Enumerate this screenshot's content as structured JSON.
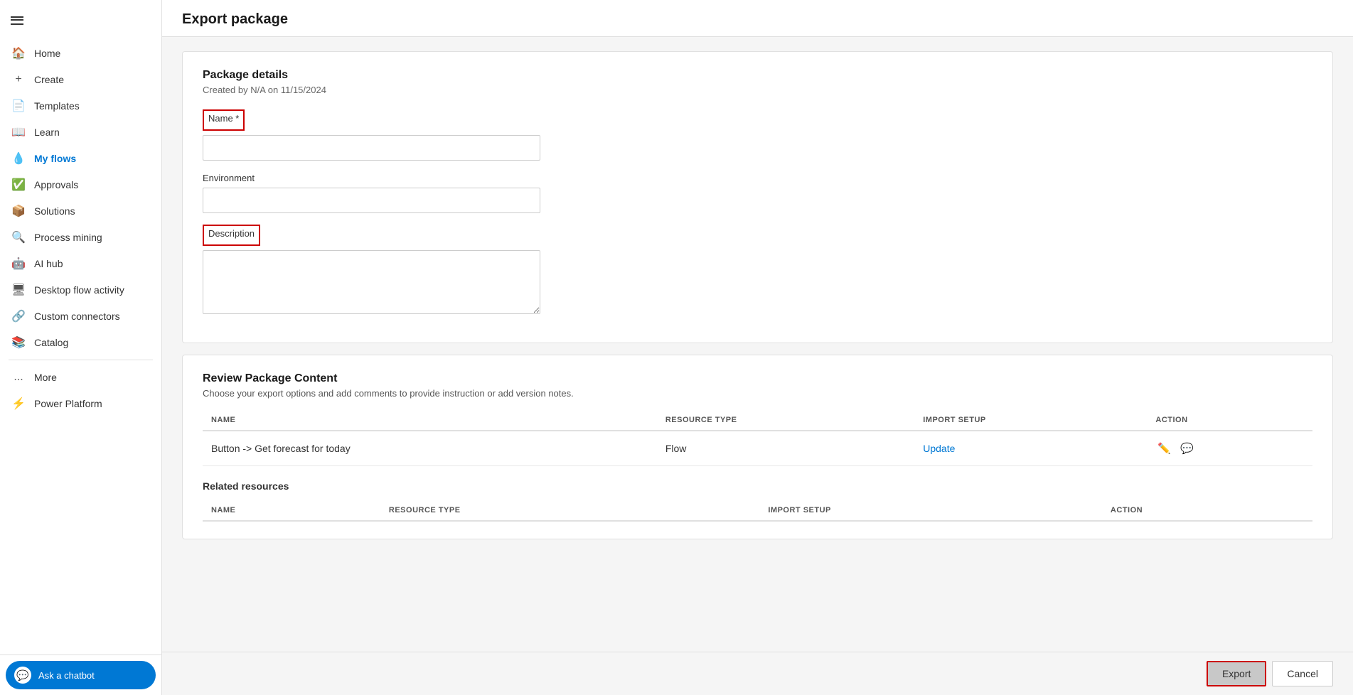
{
  "sidebar": {
    "items": [
      {
        "id": "home",
        "label": "Home",
        "icon": "🏠",
        "active": false
      },
      {
        "id": "create",
        "label": "Create",
        "icon": "+",
        "active": false
      },
      {
        "id": "templates",
        "label": "Templates",
        "icon": "📄",
        "active": false
      },
      {
        "id": "learn",
        "label": "Learn",
        "icon": "📖",
        "active": false
      },
      {
        "id": "my-flows",
        "label": "My flows",
        "icon": "💧",
        "active": true
      },
      {
        "id": "approvals",
        "label": "Approvals",
        "icon": "✅",
        "active": false
      },
      {
        "id": "solutions",
        "label": "Solutions",
        "icon": "📦",
        "active": false
      },
      {
        "id": "process-mining",
        "label": "Process mining",
        "icon": "🔍",
        "active": false
      },
      {
        "id": "ai-hub",
        "label": "AI hub",
        "icon": "🤖",
        "active": false
      },
      {
        "id": "desktop-flow",
        "label": "Desktop flow activity",
        "icon": "🖥",
        "active": false
      },
      {
        "id": "custom-connectors",
        "label": "Custom connectors",
        "icon": "🔗",
        "active": false
      },
      {
        "id": "catalog",
        "label": "Catalog",
        "icon": "📚",
        "active": false
      },
      {
        "id": "more",
        "label": "More",
        "icon": "...",
        "active": false
      },
      {
        "id": "power-platform",
        "label": "Power Platform",
        "icon": "⚡",
        "active": false
      }
    ],
    "chatbot_label": "Ask a chatbot"
  },
  "page": {
    "title": "Export package"
  },
  "package_details": {
    "title": "Package details",
    "subtitle": "Created by N/A on 11/15/2024",
    "name_label": "Name *",
    "name_placeholder": "",
    "environment_label": "Environment",
    "environment_placeholder": "",
    "description_label": "Description",
    "description_placeholder": ""
  },
  "review_package": {
    "title": "Review Package Content",
    "description": "Choose your export options and add comments to provide instruction or add version notes.",
    "table_headers": {
      "name": "NAME",
      "resource_type": "RESOURCE TYPE",
      "import_setup": "IMPORT SETUP",
      "action": "ACTION"
    },
    "rows": [
      {
        "name": "Button -> Get forecast for today",
        "resource_type": "Flow",
        "import_setup": "Update",
        "import_setup_link": true
      }
    ],
    "related_resources": {
      "title": "Related resources",
      "headers": {
        "name": "NAME",
        "resource_type": "RESOURCE TYPE",
        "import_setup": "IMPORT SETUP",
        "action": "ACTION"
      }
    }
  },
  "actions": {
    "export_label": "Export",
    "cancel_label": "Cancel"
  }
}
